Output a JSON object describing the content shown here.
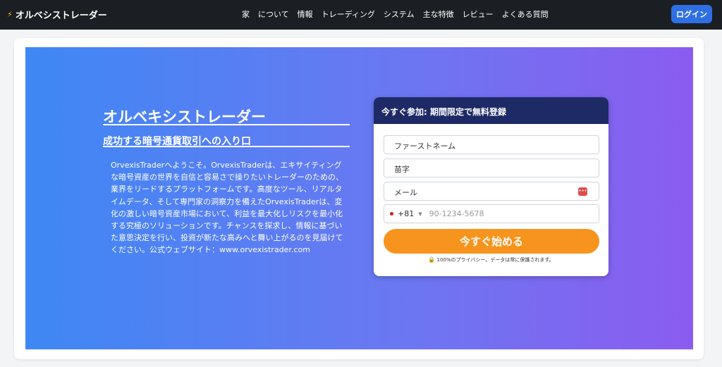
{
  "header": {
    "brand": "オルベシストレーダー",
    "brand_icon": "⚡",
    "nav": [
      "家",
      "について",
      "情報",
      "トレーディング",
      "システム",
      "主な特徴",
      "レビュー",
      "よくある質問"
    ],
    "login_label": "ログイン"
  },
  "hero": {
    "title": "オルベキシストレーダー",
    "subtitle": "成功する暗号通貨取引への入り口",
    "description": "OrvexisTraderへようこそ。OrvexisTraderは、エキサイティングな暗号資産の世界を自信と容易さで操りたいトレーダーのための、業界をリードするプラットフォームです。高度なツール、リアルタイムデータ、そして専門家の洞察力を備えたOrvexisTraderは、変化の激しい暗号資産市場において、利益を最大化しリスクを最小化する究極のソリューションです。チャンスを探求し、情報に基づいた意思決定を行い、投資が新たな高みへと舞い上がるのを見届けてください。公式ウェブサイト：www.orvexistrader.com"
  },
  "form": {
    "heading": "今すぐ参加: 期間限定で無料登録",
    "first_name_placeholder": "ファーストネーム",
    "last_name_placeholder": "苗字",
    "email_placeholder": "メール",
    "phone_code": "+81",
    "phone_placeholder": "90-1234-5678",
    "submit_label": "今すぐ始める",
    "privacy_text": "100%のプライバシー。データは常に保護されます。"
  },
  "colors": {
    "topbar": "#1b1f24",
    "login": "#2f6fe4",
    "hero_start": "#3e88f4",
    "hero_end": "#8b5cf0",
    "form_head": "#1e2a66",
    "cta": "#f7941d"
  }
}
